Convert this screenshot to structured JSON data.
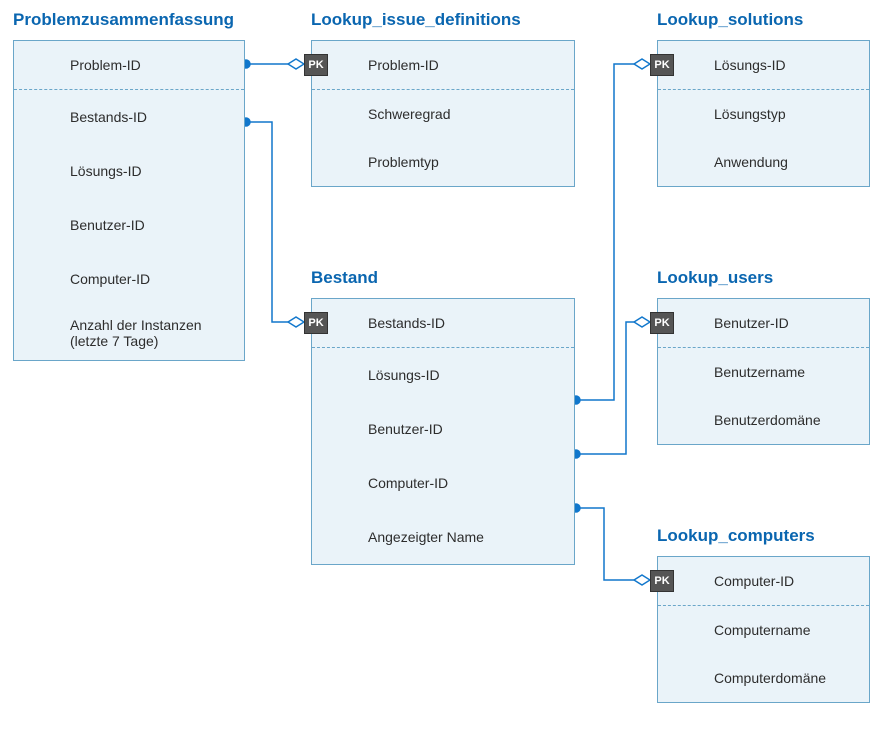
{
  "pk_label": "PK",
  "colors": {
    "accent": "#0a66b0",
    "table_bg": "#eaf3f9",
    "border": "#6aa6c9",
    "wire": "#1177cc"
  },
  "tables": {
    "problem_summary": {
      "title": "Problemzusammenfassung",
      "fields": [
        "Problem-ID",
        "Bestands-ID",
        "Lösungs-ID",
        "Benutzer-ID",
        "Computer-ID",
        "Anzahl der Instanzen (letzte 7 Tage)"
      ]
    },
    "lookup_issue_definitions": {
      "title": "Lookup_issue_definitions",
      "pk": "Problem-ID",
      "fields": [
        "Schweregrad",
        "Problemtyp"
      ]
    },
    "lookup_solutions": {
      "title": "Lookup_solutions",
      "pk": "Lösungs-ID",
      "fields": [
        "Lösungstyp",
        "Anwendung"
      ]
    },
    "bestand": {
      "title": "Bestand",
      "pk": "Bestands-ID",
      "fields": [
        "Lösungs-ID",
        "Benutzer-ID",
        "Computer-ID",
        "Angezeigter Name"
      ]
    },
    "lookup_users": {
      "title": "Lookup_users",
      "pk": "Benutzer-ID",
      "fields": [
        "Benutzername",
        "Benutzerdomäne"
      ]
    },
    "lookup_computers": {
      "title": "Lookup_computers",
      "pk": "Computer-ID",
      "fields": [
        "Computername",
        "Computerdomäne"
      ]
    }
  },
  "relationships": [
    {
      "from": "problem_summary.Problem-ID",
      "to": "lookup_issue_definitions.Problem-ID"
    },
    {
      "from": "problem_summary.Bestands-ID",
      "to": "bestand.Bestands-ID"
    },
    {
      "from": "bestand.Lösungs-ID",
      "to": "lookup_solutions.Lösungs-ID"
    },
    {
      "from": "bestand.Benutzer-ID",
      "to": "lookup_users.Benutzer-ID"
    },
    {
      "from": "bestand.Computer-ID",
      "to": "lookup_computers.Computer-ID"
    }
  ]
}
